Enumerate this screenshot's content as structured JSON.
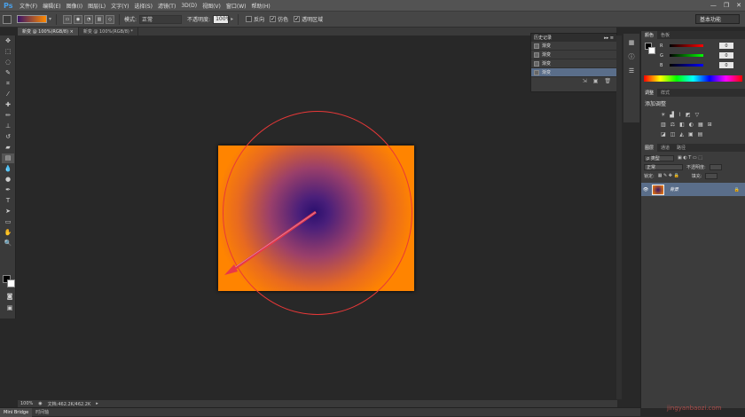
{
  "app": {
    "logo": "Ps",
    "window_controls": [
      "—",
      "❐",
      "✕"
    ]
  },
  "menu": [
    "文件(F)",
    "编辑(E)",
    "图像(I)",
    "图层(L)",
    "文字(Y)",
    "选择(S)",
    "滤镜(T)",
    "3D(D)",
    "视图(V)",
    "窗口(W)",
    "帮助(H)"
  ],
  "options": {
    "mode_label": "模式:",
    "mode_value": "正常",
    "opacity_label": "不透明度:",
    "opacity_value": "100%",
    "reverse_label": "反向",
    "dither_label": "仿色",
    "transparency_label": "透明区域",
    "workspace": "基本功能",
    "check": "✓"
  },
  "tabs": [
    {
      "label": "新变 @ 100%(RGB/8) ×"
    },
    {
      "label": "新变 @ 100%(RGB/8) *"
    }
  ],
  "history": {
    "title": "历史记录",
    "items": [
      "渐变",
      "渐变",
      "渐变",
      "渐变"
    ],
    "footer_icons": [
      "⇲",
      "▣",
      "🗑"
    ]
  },
  "color_panel": {
    "tabs": [
      "颜色",
      "色板"
    ],
    "channels": [
      {
        "label": "R",
        "value": "0"
      },
      {
        "label": "G",
        "value": "0"
      },
      {
        "label": "B",
        "value": "0"
      }
    ]
  },
  "adjust_panel": {
    "tabs": [
      "调整",
      "样式"
    ],
    "title": "添加调整"
  },
  "layers_panel": {
    "tabs": [
      "图层",
      "通道",
      "路径"
    ],
    "kind": "ρ 类型",
    "blend": "正常",
    "opacity_label": "不透明度:",
    "lock_label": "锁定:",
    "fill_label": "填充:",
    "layer_name": "背景",
    "lock_icon": "🔒"
  },
  "status": {
    "zoom": "100%",
    "doc": "文档:462.2K/462.2K"
  },
  "bottom_tabs": [
    "Mini Bridge",
    "时间轴"
  ],
  "watermark": "jingyanbaozi.com",
  "colors": {
    "accent_select": "#5a6e8a",
    "gradient_start": "#2a0f6e",
    "gradient_end": "#ff8400",
    "guide": "#e83838"
  }
}
